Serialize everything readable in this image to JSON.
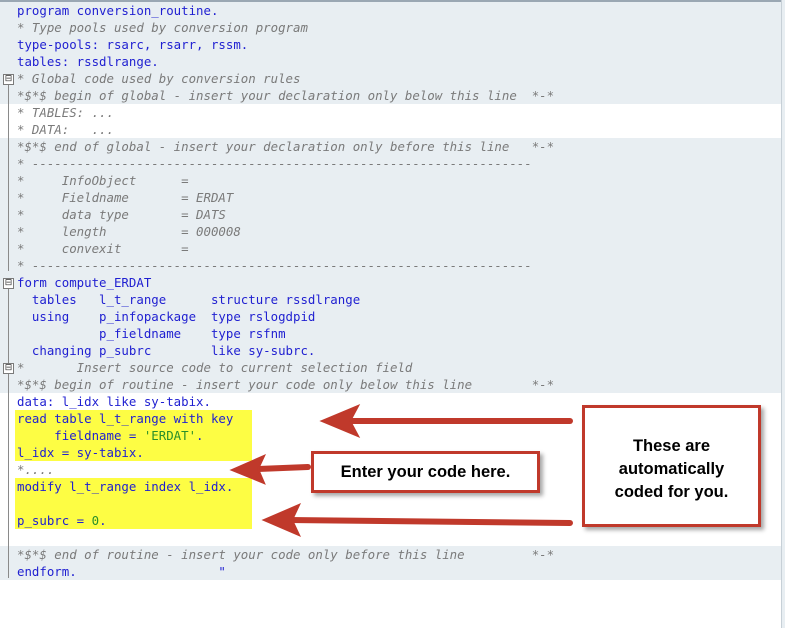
{
  "code_lines": [
    "program conversion_routine.",
    "* Type pools used by conversion program",
    "type-pools: rsarc, rsarr, rssm.",
    "tables: rssdlrange.",
    "* Global code used by conversion rules",
    "*$*$ begin of global - insert your declaration only below this line  *-*",
    "* TABLES: ...",
    "* DATA:   ...",
    "*$*$ end of global - insert your declaration only before this line   *-*",
    "* -------------------------------------------------------------------",
    "*     InfoObject      =",
    "*     Fieldname       = ERDAT",
    "*     data type       = DATS",
    "*     length          = 000008",
    "*     convexit        =",
    "* -------------------------------------------------------------------",
    "form compute_ERDAT",
    "  tables   l_t_range      structure rssdlrange",
    "  using    p_infopackage  type rslogdpid",
    "           p_fieldname    type rsfnm",
    "  changing p_subrc        like sy-subrc.",
    "*       Insert source code to current selection field",
    "*$*$ begin of routine - insert your code only below this line        *-*",
    "data: l_idx like sy-tabix.",
    "read table l_t_range with key",
    "     fieldname = 'ERDAT'.",
    "l_idx = sy-tabix.",
    "*....",
    "modify l_t_range index l_idx.",
    "",
    "p_subrc = 0.",
    "",
    "",
    "*$*$ end of routine - insert your code only before this line         *-*",
    "endform.                   \""
  ],
  "callouts": {
    "enter_code": "Enter your code here.",
    "auto_coded_line1": "These are",
    "auto_coded_line2": "automatically",
    "auto_coded_line3": "coded for you."
  },
  "fold_markers": {
    "collapse_symbol": "⊟"
  },
  "colors": {
    "keyword": "#1f1fd1",
    "comment": "#7a7a7a",
    "literal": "#2a8f2a",
    "highlight": "#fdfd44",
    "callout_border": "#c0392b",
    "arrow": "#c0392b",
    "line_background": "#e8eef2"
  }
}
